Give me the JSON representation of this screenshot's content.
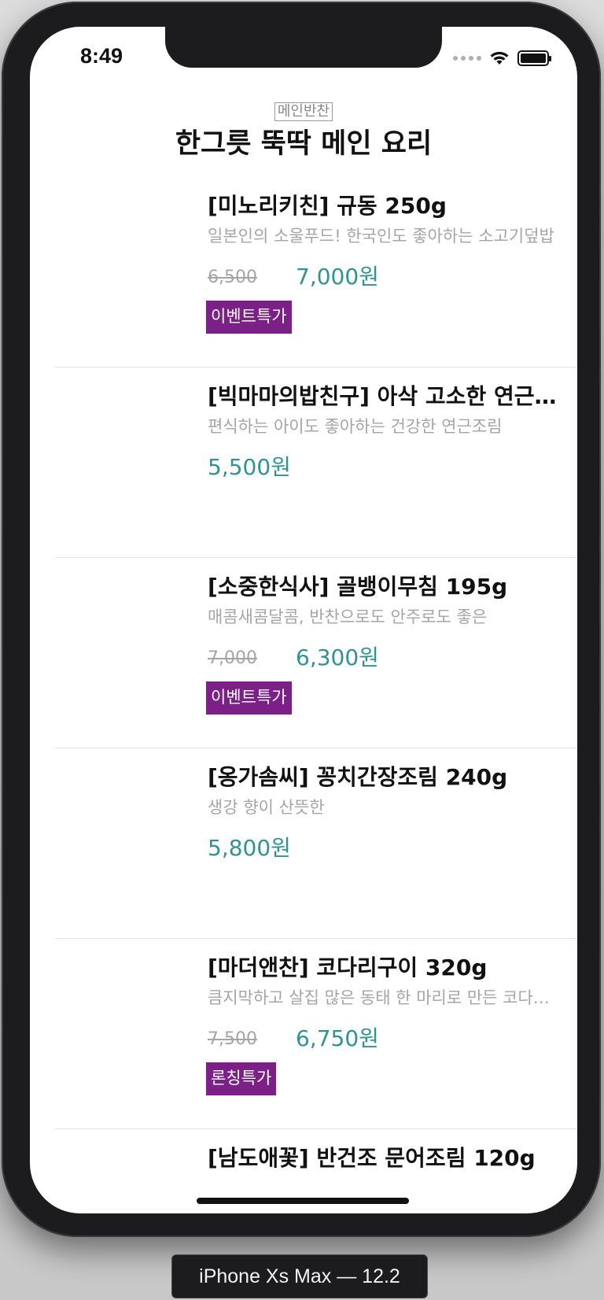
{
  "status_bar": {
    "time": "8:49",
    "icons": [
      "cellular-icon",
      "wifi-icon",
      "battery-icon"
    ]
  },
  "section": {
    "badge": "메인반찬",
    "title": "한그릇 뚝딱 메인 요리"
  },
  "items": [
    {
      "title": "[미노리키친] 규동 250g",
      "description": "일본인의 소울푸드! 한국인도 좋아하는 소고기덮밥",
      "original_price": "6,500",
      "sale_price": "7,000원",
      "badge": "이벤트특가"
    },
    {
      "title": "[빅마마의밥친구] 아삭 고소한 연근고…",
      "description": "편식하는 아이도 좋아하는 건강한 연근조림",
      "original_price": "",
      "sale_price": "5,500원",
      "badge": ""
    },
    {
      "title": "[소중한식사] 골뱅이무침 195g",
      "description": "매콤새콤달콤, 반찬으로도 안주로도 좋은",
      "original_price": "7,000",
      "sale_price": "6,300원",
      "badge": "이벤트특가"
    },
    {
      "title": "[옹가솜씨] 꽁치간장조림 240g",
      "description": "생강 향이 산뜻한",
      "original_price": "",
      "sale_price": "5,800원",
      "badge": ""
    },
    {
      "title": "[마더앤찬] 코다리구이 320g",
      "description": "큼지막하고 살집 많은 동태 한 마리로 만든 코다…",
      "original_price": "7,500",
      "sale_price": "6,750원",
      "badge": "론칭특가"
    },
    {
      "title": "[남도애꽃] 반건조 문어조림 120g",
      "description": "",
      "original_price": "",
      "sale_price": "",
      "badge": ""
    }
  ],
  "simulator": {
    "device_label": "iPhone Xs Max — 12.2"
  },
  "colors": {
    "accent_price": "#2f9393",
    "badge_bg": "#7b2086",
    "muted_text": "#a5a5a5"
  }
}
